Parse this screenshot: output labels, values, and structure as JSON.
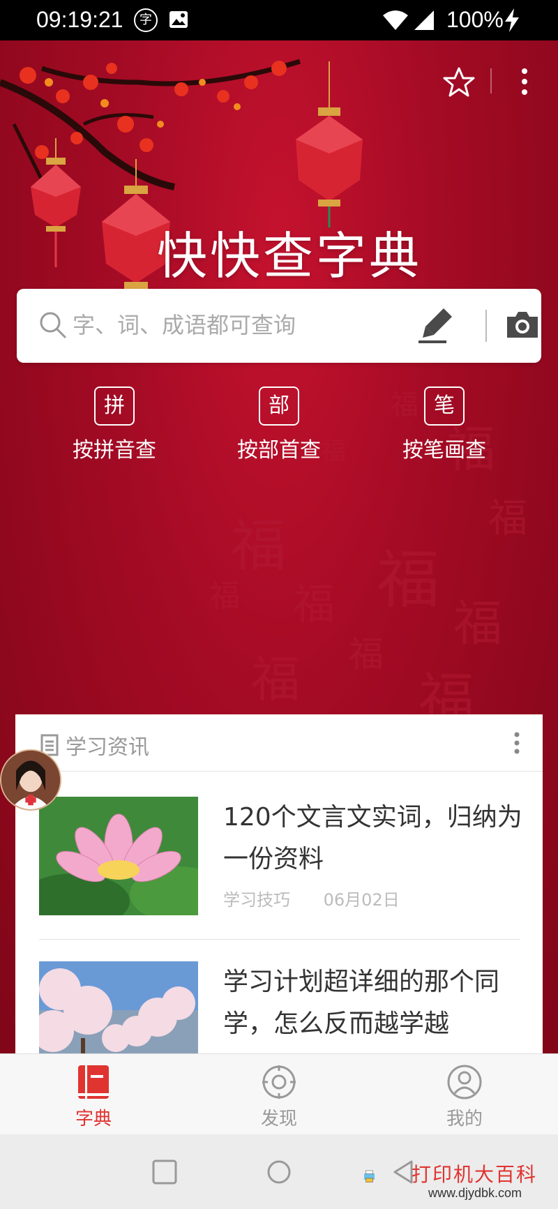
{
  "status_bar": {
    "time": "09:19:21",
    "app_icon_glyph": "字",
    "battery": "100%",
    "icons": [
      "dictionary-app-icon",
      "image-icon",
      "wifi-icon",
      "signal-icon",
      "charging-icon"
    ]
  },
  "header": {
    "title": "快快查字典",
    "icons": [
      "star-icon",
      "more-vert-icon"
    ],
    "decoration_glyph": "福"
  },
  "search": {
    "placeholder": "字、词、成语都可查询",
    "icons": [
      "search-icon",
      "handwriting-icon",
      "camera-icon"
    ]
  },
  "lookup_modes": [
    {
      "badge": "拼",
      "label": "按拼音查"
    },
    {
      "badge": "部",
      "label": "按部首查"
    },
    {
      "badge": "笔",
      "label": "按笔画查"
    }
  ],
  "news": {
    "section_title": "学习资讯",
    "items": [
      {
        "headline": "120个文言文实词，归纳为一份资料",
        "category": "学习技巧",
        "date": "06月02日",
        "thumb": "lotus-flower-image"
      },
      {
        "headline": "学习计划超详细的那个同学，怎么反而越学越",
        "category": "",
        "date": "",
        "thumb": "cherry-blossom-image"
      }
    ]
  },
  "bottom_nav": [
    {
      "label": "字典",
      "active": true,
      "icon": "book-icon"
    },
    {
      "label": "发现",
      "active": false,
      "icon": "compass-icon"
    },
    {
      "label": "我的",
      "active": false,
      "icon": "user-icon"
    }
  ],
  "watermark": {
    "text": "打印机大百科",
    "url": "www.djydbk.com"
  },
  "colors": {
    "primary_red": "#e03431",
    "hero_red": "#a50b25"
  }
}
